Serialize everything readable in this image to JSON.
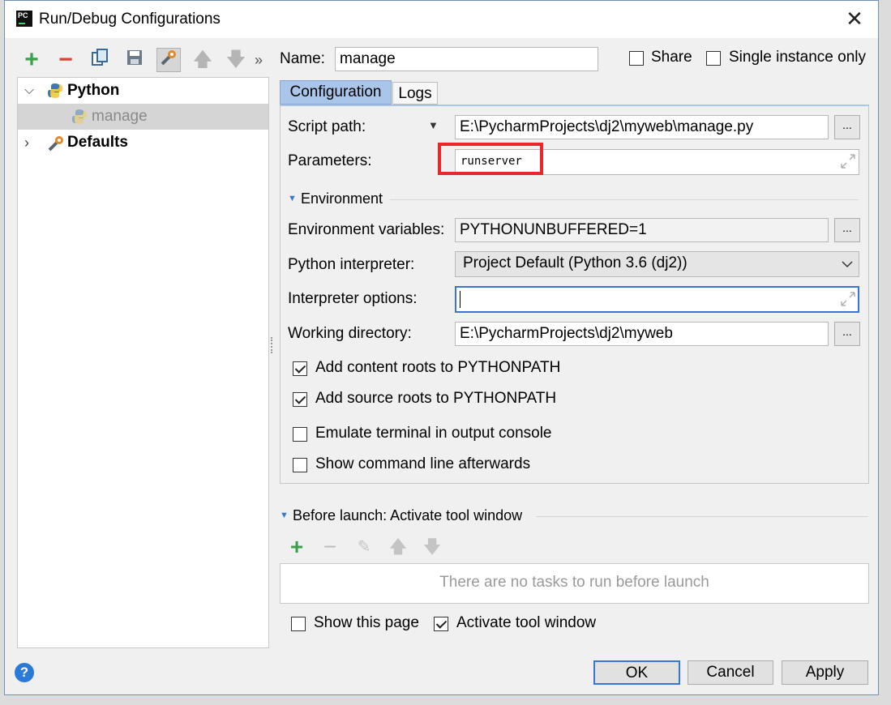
{
  "window": {
    "title": "Run/Debug Configurations",
    "app_icon": "PC"
  },
  "toolbar": {
    "icons": [
      "add-icon",
      "remove-icon",
      "copy-icon",
      "save-icon",
      "edit-defaults-icon",
      "move-up-icon",
      "move-down-icon",
      "more-icon"
    ],
    "more_glyph": "»"
  },
  "tree": {
    "python_label": "Python",
    "manage_label": "manage",
    "defaults_label": "Defaults"
  },
  "header": {
    "name_label": "Name:",
    "name_value": "manage",
    "share_label": "Share",
    "single_instance_label": "Single instance only"
  },
  "tabs": [
    {
      "label": "Configuration"
    },
    {
      "label": "Logs"
    }
  ],
  "config": {
    "script_path_label": "Script path:",
    "script_path_value": "E:\\PycharmProjects\\dj2\\myweb\\manage.py",
    "parameters_label": "Parameters:",
    "parameters_value": "runserver",
    "environment_section": "Environment",
    "env_vars_label": "Environment variables:",
    "env_vars_value": "PYTHONUNBUFFERED=1",
    "interpreter_label": "Python interpreter:",
    "interpreter_value": "Project Default (Python 3.6 (dj2))",
    "interp_options_label": "Interpreter options:",
    "interp_options_value": "",
    "working_dir_label": "Working directory:",
    "working_dir_value": "E:\\PycharmProjects\\dj2\\myweb",
    "browse_label": "...",
    "checkboxes": [
      {
        "label": "Add content roots to PYTHONPATH",
        "checked": true
      },
      {
        "label": "Add source roots to PYTHONPATH",
        "checked": true
      },
      {
        "label": "Emulate terminal in output console",
        "checked": false
      },
      {
        "label": "Show command line afterwards",
        "checked": false
      }
    ]
  },
  "before_launch": {
    "title": "Before launch: Activate tool window",
    "empty_text": "There are no tasks to run before launch",
    "show_page_label": "Show this page",
    "show_page_checked": false,
    "activate_label": "Activate tool window",
    "activate_checked": true
  },
  "buttons": {
    "ok": "OK",
    "cancel": "Cancel",
    "apply": "Apply",
    "help": "?"
  },
  "colors": {
    "accent": "#3875d7",
    "highlight_box": "#e8262b",
    "add_green": "#3aa04a",
    "remove_red": "#d7443b"
  }
}
